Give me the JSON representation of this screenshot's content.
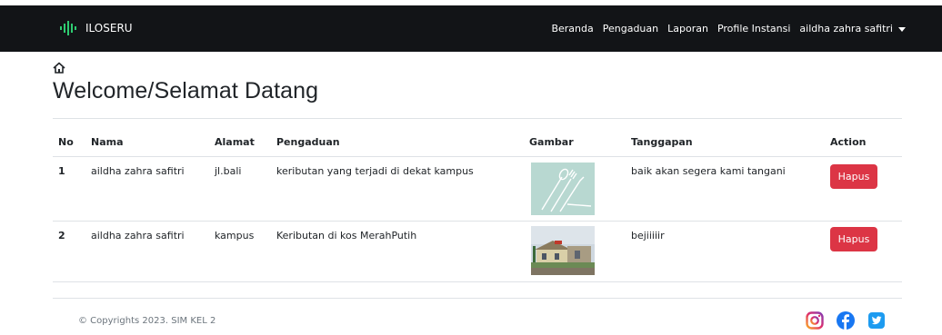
{
  "navbar": {
    "brand": "ILOSERU",
    "items": [
      "Beranda",
      "Pengaduan",
      "Laporan",
      "Profile Instansi"
    ],
    "user": "aildha zahra safitri"
  },
  "page": {
    "title": "Welcome/Selamat Datang"
  },
  "table": {
    "headers": [
      "No",
      "Nama",
      "Alamat",
      "Pengaduan",
      "Gambar",
      "Tanggapan",
      "Action"
    ],
    "rows": [
      {
        "no": "1",
        "nama": "aildha zahra safitri",
        "alamat": "jl.bali",
        "pengaduan": "keributan yang terjadi di dekat kampus",
        "gambar": "cutlery-image",
        "tanggapan": "baik akan segera kami tangani",
        "action": "Hapus"
      },
      {
        "no": "2",
        "nama": "aildha zahra safitri",
        "alamat": "kampus",
        "pengaduan": "Keributan di kos MerahPutih",
        "gambar": "building-photo",
        "tanggapan": "bejiiiiir",
        "action": "Hapus"
      }
    ]
  },
  "footer": {
    "copyright": "© Copyrights 2023. SIM KEL 2"
  },
  "socials": [
    "instagram-icon",
    "facebook-icon",
    "twitter-icon"
  ],
  "colors": {
    "navbar_bg": "#121417",
    "danger": "#dc3545",
    "instagram": "#c13584",
    "facebook": "#1877f2",
    "twitter": "#1da1f2"
  }
}
